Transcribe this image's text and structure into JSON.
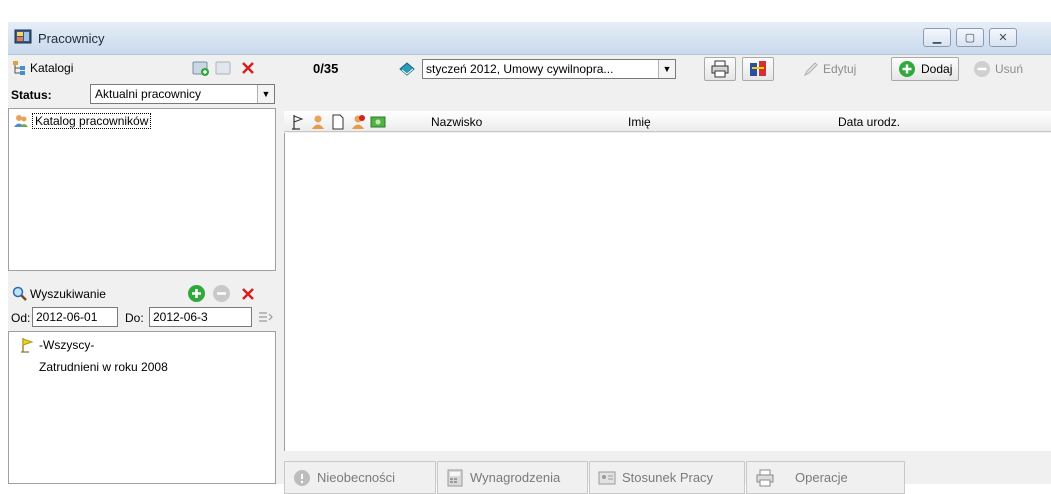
{
  "window": {
    "title": "Pracownicy"
  },
  "catalogs": {
    "title": "Katalogi",
    "status_label": "Status:",
    "status_value": "Aktualni pracownicy",
    "items": [
      "Katalog pracowników"
    ]
  },
  "search": {
    "title": "Wyszukiwanie",
    "from_label": "Od:",
    "from_value": "2012-06-01",
    "to_label": "Do:",
    "to_value": "2012-06-3",
    "items": [
      "-Wszyscy-",
      "Zatrudnieni w roku 2008"
    ]
  },
  "toolbar": {
    "count": "0/35",
    "period_value": "styczeń 2012, Umowy cywilnopra...",
    "edit_label": "Edytuj",
    "add_label": "Dodaj",
    "delete_label": "Usuń"
  },
  "grid": {
    "columns": [
      "Nazwisko",
      "Imię",
      "Data urodz."
    ]
  },
  "bottom_tabs": [
    "Nieobecności",
    "Wynagrodzenia",
    "Stosunek Pracy",
    "Operacje"
  ],
  "colors": {
    "accent_green": "#2fa83c",
    "close_red": "#d42020"
  }
}
